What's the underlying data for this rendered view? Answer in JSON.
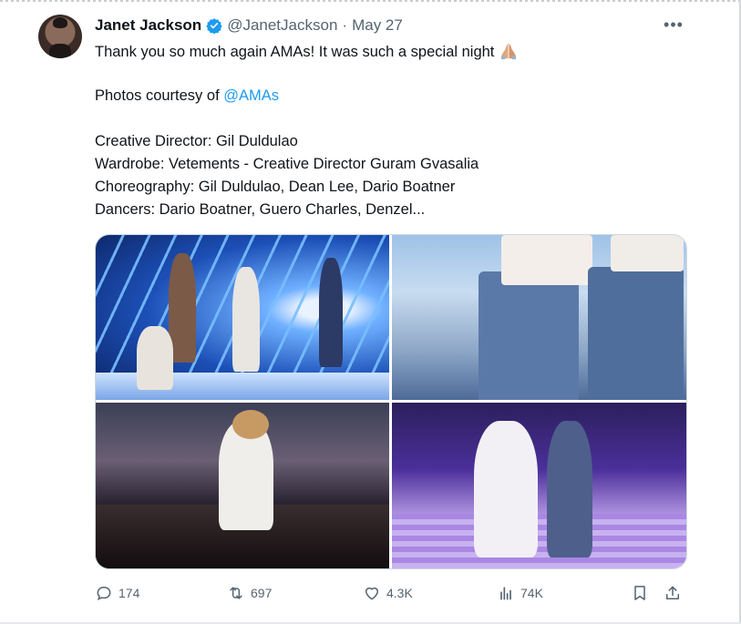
{
  "tweet": {
    "author_name": "Janet Jackson",
    "handle": "@JanetJackson",
    "separator": "·",
    "date": "May 27",
    "line1": "Thank you so much again AMAs! It was such a special night",
    "photos_prefix": "Photos courtesy of ",
    "photos_mention": "@AMAs",
    "line_creative": "Creative Director: Gil Duldulao",
    "line_wardrobe": "Wardrobe: Vetements - Creative Director Guram Gvasalia",
    "line_choreo": "Choreography: Gil Duldulao, Dean Lee, Dario Boatner",
    "line_dancers": "Dancers: Dario Boatner, Guero Charles, Denzel..."
  },
  "actions": {
    "replies": "174",
    "retweets": "697",
    "likes": "4.3K",
    "views": "74K"
  },
  "icons": [
    "verified-icon",
    "more-icon",
    "folded-hands-emoji",
    "reply-icon",
    "retweet-icon",
    "like-icon",
    "views-icon",
    "bookmark-icon",
    "share-icon"
  ],
  "colors": {
    "accent": "#1d9bf0",
    "text": "#0f1419",
    "muted": "#536471"
  }
}
